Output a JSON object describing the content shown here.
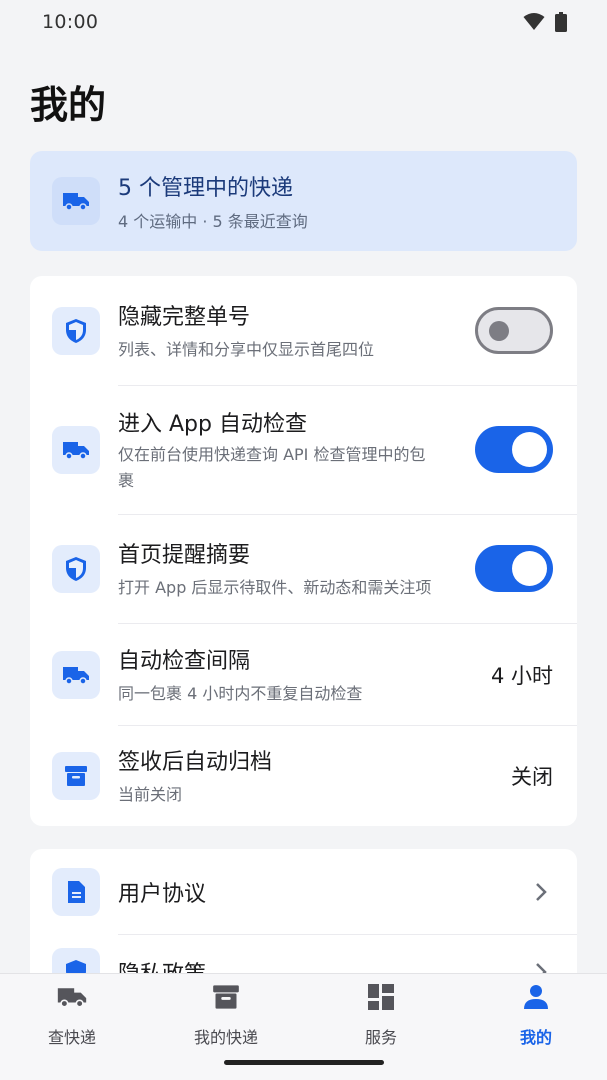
{
  "status_bar": {
    "time": "10:00",
    "icons": [
      "wifi-icon",
      "battery-icon"
    ]
  },
  "page": {
    "title": "我的"
  },
  "summary": {
    "icon": "truck-icon",
    "title": "5 个管理中的快递",
    "subtitle": "4 个运输中 · 5 条最近查询"
  },
  "settings": [
    {
      "icon": "shield-icon",
      "title": "隐藏完整单号",
      "subtitle": "列表、详情和分享中仅显示首尾四位",
      "control": "toggle",
      "enabled": false
    },
    {
      "icon": "truck-icon",
      "title": "进入 App 自动检查",
      "subtitle_line1": "仅在前台使用快递查询 API 检查管理中的包",
      "subtitle_line2": "裹",
      "control": "toggle",
      "enabled": true
    },
    {
      "icon": "shield-icon",
      "title": "首页提醒摘要",
      "subtitle": "打开 App 后显示待取件、新动态和需关注项",
      "control": "toggle",
      "enabled": true
    },
    {
      "icon": "truck-icon",
      "title": "自动检查间隔",
      "subtitle": "同一包裹 4 小时内不重复自动检查",
      "control": "value",
      "value": "4 小时"
    },
    {
      "icon": "archive-icon",
      "title": "签收后自动归档",
      "subtitle": "当前关闭",
      "control": "value",
      "value": "关闭"
    }
  ],
  "legal": [
    {
      "icon": "document-icon",
      "title": "用户协议"
    },
    {
      "icon": "shield-icon",
      "title": "隐私政策"
    }
  ],
  "bottom_nav": [
    {
      "icon": "truck-icon",
      "label": "查快递",
      "active": false
    },
    {
      "icon": "archive-icon",
      "label": "我的快递",
      "active": false
    },
    {
      "icon": "grid-icon",
      "label": "服务",
      "active": false
    },
    {
      "icon": "person-icon",
      "label": "我的",
      "active": true
    }
  ],
  "colors": {
    "accent": "#1a64e8",
    "summary_bg": "#dde8fb",
    "background": "#f3f4f6"
  }
}
